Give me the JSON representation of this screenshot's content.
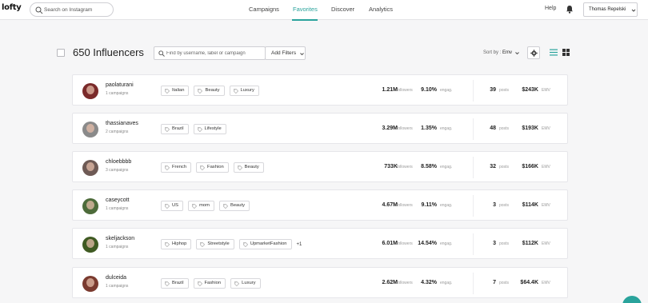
{
  "brand": {
    "logo_text": "lofty"
  },
  "header": {
    "search_placeholder": "Search on Instagram",
    "nav": [
      {
        "label": "Campaigns",
        "active": false
      },
      {
        "label": "Favorites",
        "active": true
      },
      {
        "label": "Discover",
        "active": false
      },
      {
        "label": "Analytics",
        "active": false
      }
    ],
    "help_label": "Help",
    "user_name": "Thomas Repelski"
  },
  "toolbar": {
    "count_label": "650 Influencers",
    "find_placeholder": "Find by username, label or campaign",
    "add_filters_label": "Add Filters",
    "sort_prefix": "Sort by :",
    "sort_value": "Emv"
  },
  "colors": {
    "accent": "#2aa39c",
    "text": "#222222",
    "muted": "#888888",
    "border": "#d8d8dc"
  },
  "influencers": [
    {
      "username": "paolaturani",
      "campaigns": "1 campaigns",
      "tags": [
        "Italian",
        "Beauty",
        "Luxury"
      ],
      "more": "",
      "followers": "1.21M",
      "followers_unit": "followers",
      "engagement": "9.10%",
      "engagement_unit": "engag.",
      "posts": "39",
      "posts_unit": "posts",
      "emv": "$243K",
      "emv_unit": "EMV",
      "avatar_color": "#7a2a2a"
    },
    {
      "username": "thassianaves",
      "campaigns": "2 campaigns",
      "tags": [
        "Brazil",
        "Lifestyle"
      ],
      "more": "",
      "followers": "3.29M",
      "followers_unit": "followers",
      "engagement": "1.35%",
      "engagement_unit": "engag.",
      "posts": "48",
      "posts_unit": "posts",
      "emv": "$193K",
      "emv_unit": "EMV",
      "avatar_color": "#8a8a8a"
    },
    {
      "username": "chloebbbb",
      "campaigns": "3 campaigns",
      "tags": [
        "French",
        "Fashion",
        "Beauty"
      ],
      "more": "",
      "followers": "733K",
      "followers_unit": "followers",
      "engagement": "8.58%",
      "engagement_unit": "engag.",
      "posts": "32",
      "posts_unit": "posts",
      "emv": "$166K",
      "emv_unit": "EMV",
      "avatar_color": "#6e5a55"
    },
    {
      "username": "caseycott",
      "campaigns": "1 campaigns",
      "tags": [
        "US",
        "mom",
        "Beauty"
      ],
      "more": "",
      "followers": "4.67M",
      "followers_unit": "followers",
      "engagement": "9.11%",
      "engagement_unit": "engag.",
      "posts": "3",
      "posts_unit": "posts",
      "emv": "$114K",
      "emv_unit": "EMV",
      "avatar_color": "#4d6b3a"
    },
    {
      "username": "skeljackson",
      "campaigns": "1 campaigns",
      "tags": [
        "Hiphop",
        "Streetstyle",
        "UpmarketFashion"
      ],
      "more": "+1",
      "followers": "6.01M",
      "followers_unit": "followers",
      "engagement": "14.54%",
      "engagement_unit": "engag.",
      "posts": "3",
      "posts_unit": "posts",
      "emv": "$112K",
      "emv_unit": "EMV",
      "avatar_color": "#3f5a22"
    },
    {
      "username": "dulceida",
      "campaigns": "1 campaigns",
      "tags": [
        "Brazil",
        "Fashion",
        "Luxury"
      ],
      "more": "",
      "followers": "2.62M",
      "followers_unit": "followers",
      "engagement": "4.32%",
      "engagement_unit": "engag.",
      "posts": "7",
      "posts_unit": "posts",
      "emv": "$64.4K",
      "emv_unit": "EMV",
      "avatar_color": "#7a3a2f"
    }
  ]
}
